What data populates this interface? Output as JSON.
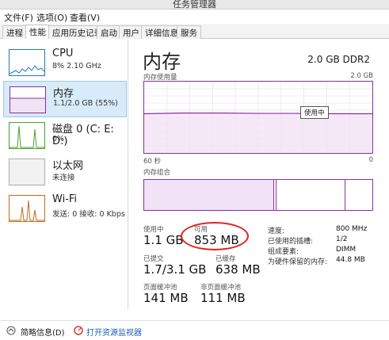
{
  "window": {
    "title": "任务管理器"
  },
  "menu": [
    "文件(F)",
    "选项(O)",
    "查看(V)"
  ],
  "tabs": [
    "进程",
    "性能",
    "应用历史记录",
    "启动",
    "用户",
    "详细信息",
    "服务"
  ],
  "active_tab": 1,
  "sidebar": {
    "items": [
      {
        "name": "CPU",
        "sub": "8% 2.10 GHz",
        "color": "#1f7ab8"
      },
      {
        "name": "内存",
        "sub": "1.1/2.0 GB (55%)",
        "color": "#8b2fa3"
      },
      {
        "name": "磁盘 0 (C: E: D:)",
        "sub": "0%",
        "color": "#4aa02c"
      },
      {
        "name": "以太网",
        "sub": "未连接",
        "color": "#aaaaaa"
      },
      {
        "name": "Wi-Fi",
        "sub": "发送: 0 接收: 0 Kbps",
        "color": "#c46a1b"
      }
    ]
  },
  "main": {
    "title": "内存",
    "hardware": "2.0 GB DDR2",
    "usage_label": "内存使用量",
    "usage_max": "2.0 GB",
    "time_left": "60 秒",
    "time_right": "0",
    "composition_label": "内存组合",
    "tooltip": "使用中"
  },
  "stats": {
    "in_use_label": "使用中",
    "in_use": "1.1 GB",
    "available_label": "可用",
    "available": "853 MB",
    "committed_label": "已提交",
    "committed": "1.7/3.1 GB",
    "cached_label": "已缓存",
    "cached": "638 MB",
    "paged_label": "页面缓冲池",
    "paged": "141 MB",
    "nonpaged_label": "非页面缓冲池",
    "nonpaged": "111 MB"
  },
  "details": [
    {
      "label": "速度:",
      "value": "800 MHz"
    },
    {
      "label": "已使用的插槽:",
      "value": "1/2"
    },
    {
      "label": "组成要素:",
      "value": "DIMM"
    },
    {
      "label": "为硬件保留的内存:",
      "value": "44.8 MB"
    }
  ],
  "chart_data": {
    "type": "area",
    "title": "内存使用量",
    "xlabel": "",
    "ylabel": "",
    "x": [
      60,
      50,
      40,
      30,
      20,
      10,
      0
    ],
    "ylim": [
      0,
      2.0
    ],
    "series": [
      {
        "values": [
          1.1,
          1.12,
          1.12,
          1.11,
          1.11,
          1.1,
          1.1
        ]
      }
    ]
  },
  "footer": {
    "brief": "简略信息(D)",
    "monitor": "打开资源监视器"
  }
}
